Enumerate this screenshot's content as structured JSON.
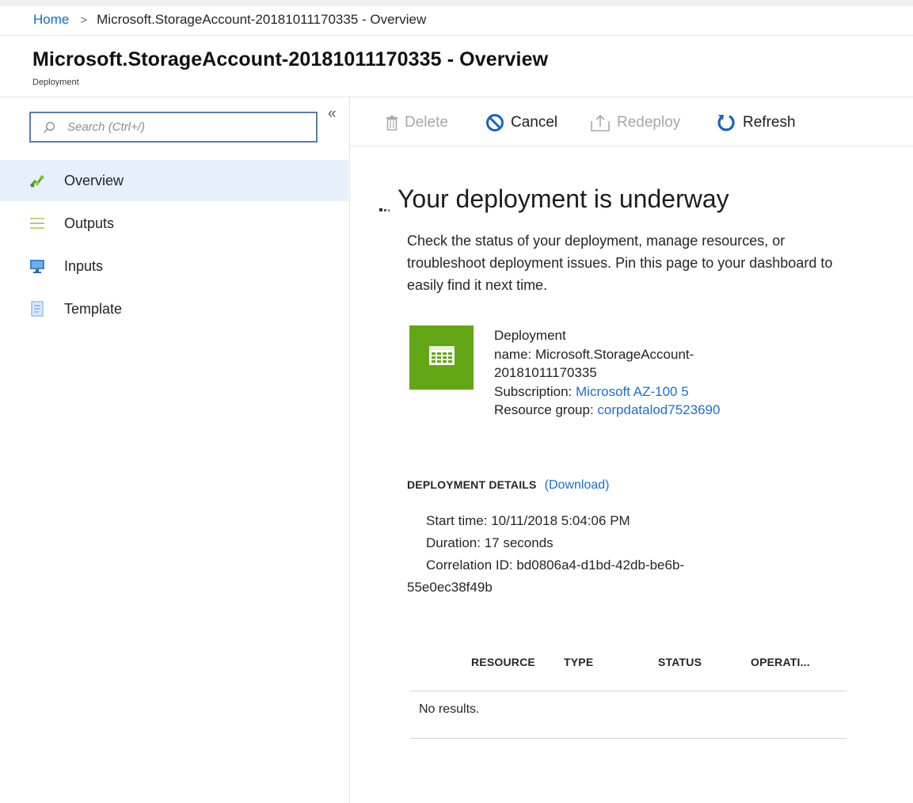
{
  "breadcrumb": {
    "home": "Home",
    "separator": ">",
    "current": "Microsoft.StorageAccount-20181011170335 - Overview"
  },
  "header": {
    "title": "Microsoft.StorageAccount-20181011170335 - Overview",
    "subtitle": "Deployment"
  },
  "sidebar": {
    "search_placeholder": "Search (Ctrl+/)",
    "collapse_glyph": "«",
    "items": [
      {
        "label": "Overview",
        "icon": "overview-icon",
        "active": true
      },
      {
        "label": "Outputs",
        "icon": "outputs-icon",
        "active": false
      },
      {
        "label": "Inputs",
        "icon": "inputs-icon",
        "active": false
      },
      {
        "label": "Template",
        "icon": "template-icon",
        "active": false
      }
    ]
  },
  "toolbar": {
    "delete_label": "Delete",
    "cancel_label": "Cancel",
    "redeploy_label": "Redeploy",
    "refresh_label": "Refresh"
  },
  "main": {
    "headline": "Your deployment is underway",
    "description": "Check the status of your deployment, manage resources, or troubleshoot deployment issues. Pin this page to your dashboard to easily find it next time.",
    "deployment": {
      "heading": "Deployment",
      "name_label": "name:",
      "name_value_line1": "Microsoft.StorageAccount-",
      "name_value_line2": "20181011170335",
      "subscription_label": "Subscription:",
      "subscription_value": "Microsoft AZ-100 5",
      "resource_group_label": "Resource group:",
      "resource_group_value": "corpdatalod7523690"
    },
    "details": {
      "heading": "DEPLOYMENT DETAILS",
      "download_label": "(Download)",
      "start_time_label": "Start time:",
      "start_time_value": "10/11/2018 5:04:06 PM",
      "duration_label": "Duration:",
      "duration_value": "17 seconds",
      "correlation_label": "Correlation ID:",
      "correlation_value_line1": "bd0806a4-d1bd-42db-be6b-",
      "correlation_value_line2": "55e0ec38f49b"
    },
    "table": {
      "columns": [
        "RESOURCE",
        "TYPE",
        "STATUS",
        "OPERATI..."
      ],
      "empty_text": "No results."
    }
  },
  "colors": {
    "accent": "#0a6ec8",
    "active_nav_bg": "#e6f0fa",
    "deployment_tile": "#63a615",
    "link": "#1c6ed3"
  }
}
